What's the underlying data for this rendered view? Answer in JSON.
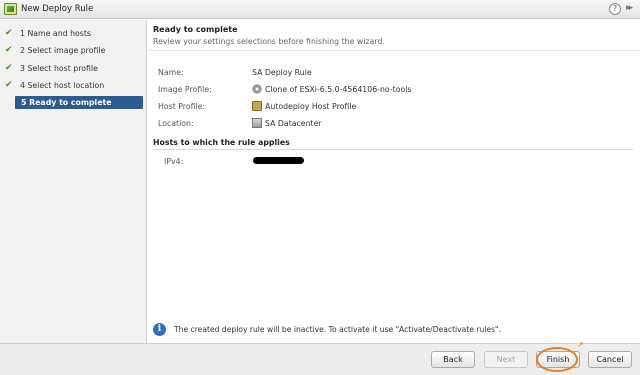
{
  "window": {
    "title": "New Deploy Rule",
    "help_label": "?",
    "expand_label": "▸▸"
  },
  "colors": {
    "active_step_bg": "#2d5a8f",
    "check": "#4a8f2a",
    "highlight_ring": "#e67e22",
    "info_icon": "#2a72c0"
  },
  "steps": [
    {
      "label": "1  Name and hosts",
      "check": "✔"
    },
    {
      "label": "2  Select image profile",
      "check": "✔"
    },
    {
      "label": "3  Select host profile",
      "check": "✔"
    },
    {
      "label": "4  Select host location",
      "check": "✔"
    },
    {
      "label": "5  Ready to complete"
    }
  ],
  "page": {
    "title": "Ready to complete",
    "subtitle": "Review your settings selections before finishing the wizard."
  },
  "summary": [
    {
      "key": "Name:",
      "value": "SA Deploy Rule",
      "icon": ""
    },
    {
      "key": "Image Profile:",
      "value": "Clone of ESXi-6.5.0-4564106-no-tools",
      "icon": "cd-icon"
    },
    {
      "key": "Host Profile:",
      "value": "Autodeploy Host Profile",
      "icon": "host-profile-icon"
    },
    {
      "key": "Location:",
      "value": "SA Datacenter",
      "icon": "datacenter-icon"
    }
  ],
  "hosts": {
    "heading": "Hosts to which the rule applies",
    "ipv4_label": "IPv4:"
  },
  "info": {
    "icon": "info-icon",
    "glyph": "i",
    "text": "The created deploy rule will be inactive. To activate it use \"Activate/Deactivate rules\"."
  },
  "buttons": {
    "back": "Back",
    "next": "Next",
    "finish": "Finish",
    "cancel": "Cancel"
  },
  "annotation": {
    "arrow": "↗"
  }
}
